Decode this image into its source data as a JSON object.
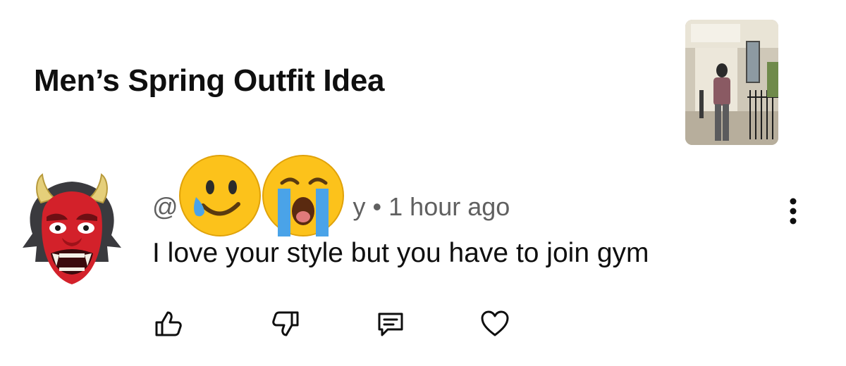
{
  "video": {
    "title": "Men’s Spring Outfit Idea",
    "thumbnail_icon": "video-thumbnail"
  },
  "comment": {
    "avatar_icon": "red-oni-mask-avatar",
    "handle_prefix": "@",
    "handle_suffix": "y",
    "handle_overlay_icons": [
      "smiling-face-with-tear-emoji",
      "loudly-crying-face-emoji"
    ],
    "separator": "•",
    "timestamp": "1 hour ago",
    "text": "I love your style but you have to join gym",
    "more_icon": "more-vertical-icon"
  },
  "actions": [
    {
      "icon": "thumbs-up-icon"
    },
    {
      "icon": "thumbs-down-icon"
    },
    {
      "icon": "reply-comment-icon"
    },
    {
      "icon": "heart-icon"
    }
  ],
  "colors": {
    "text_primary": "#0f0f0f",
    "text_secondary": "#606060"
  }
}
